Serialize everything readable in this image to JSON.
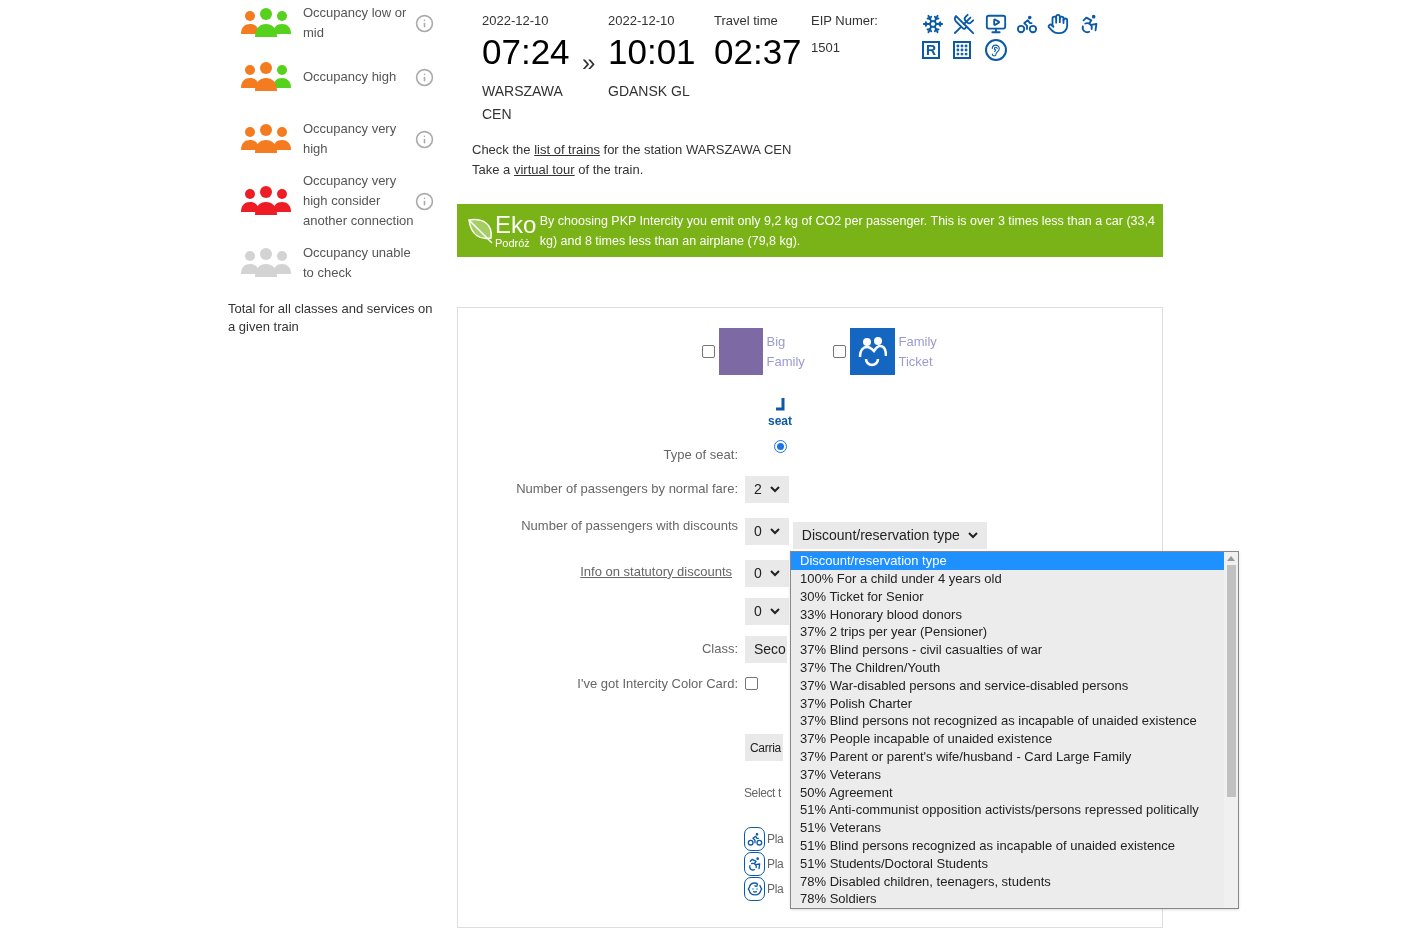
{
  "occupancy_legend": [
    {
      "kind": "low_mid",
      "label": "Occupancy low or mid"
    },
    {
      "kind": "high",
      "label": "Occupancy high"
    },
    {
      "kind": "very_high",
      "label": "Occupancy very high"
    },
    {
      "kind": "critical",
      "label": "Occupancy very high consider another connection"
    },
    {
      "kind": "unknown",
      "label": "Occupancy unable to check"
    }
  ],
  "legend_note": "Total for all classes and services on a given train",
  "journey": {
    "departure": {
      "date": "2022-12-10",
      "time": "07:24",
      "station": "WARSZAWA CEN"
    },
    "separator": "»",
    "arrival": {
      "date": "2022-12-10",
      "time": "10:01",
      "station": "GDANSK GL"
    },
    "travel_time": {
      "label": "Travel time",
      "value": "02:37"
    },
    "train_number": {
      "label": "EIP Numer:",
      "value": "1501"
    },
    "services": [
      {
        "kind": "aircon"
      },
      {
        "kind": "restaurant"
      },
      {
        "kind": "screen"
      },
      {
        "kind": "bike"
      },
      {
        "kind": "touch"
      },
      {
        "kind": "wheelchair"
      },
      {
        "kind": "reservation",
        "label": "R"
      },
      {
        "kind": "braille"
      },
      {
        "kind": "hearing"
      }
    ]
  },
  "links": [
    {
      "before": "Check the ",
      "link": "list of trains",
      "after": " for the station WARSZAWA CEN"
    },
    {
      "before": "Take a ",
      "link": "virtual tour",
      "after": " of the train."
    }
  ],
  "eco_banner": {
    "logo_title": "Eko",
    "logo_subtitle": "Podróż",
    "text": "By choosing PKP Intercity you emit only 9,2 kg of CO2 per passenger. This is over 3 times less than a car (33,4  kg) and 8 times less than an airplane (79,8 kg)."
  },
  "offers": [
    {
      "kind": "big_family",
      "label": "Big Family",
      "checked": false
    },
    {
      "kind": "family_ticket",
      "label": "Family Ticket",
      "checked": false
    }
  ],
  "seat_types": [
    {
      "label": "seat",
      "selected": true
    }
  ],
  "seat_type_label": "Type of seat:",
  "normal_fare": {
    "label": "Number of passengers by normal fare:",
    "value": "2"
  },
  "discount_rows": [
    {
      "label": "Number of passengers with discounts",
      "count": "0",
      "type": "Discount/reservation type"
    },
    {
      "link": "Info on statutory discounts",
      "count": "0"
    },
    {
      "count": "0"
    }
  ],
  "class": {
    "label": "Class:",
    "value": "Seco"
  },
  "color_card": {
    "label": "I've got Intercity Color Card:",
    "checked": false
  },
  "carriage_button": "Carria",
  "select_text": "Select t",
  "places": [
    {
      "kind": "bike",
      "label": "Pla"
    },
    {
      "kind": "wheelchair",
      "label": "Pla"
    },
    {
      "kind": "family",
      "label": "Pla"
    }
  ],
  "dropdown": {
    "options": [
      {
        "label": "Discount/reservation type",
        "selected": true
      },
      {
        "label": "100% For a child under 4 years old",
        "selected": false
      },
      {
        "label": "30% Ticket for Senior",
        "selected": false
      },
      {
        "label": "33% Honorary blood donors",
        "selected": false
      },
      {
        "label": "37% 2 trips per year (Pensioner)",
        "selected": false
      },
      {
        "label": "37% Blind persons - civil casualties of war",
        "selected": false
      },
      {
        "label": "37% The Children/Youth",
        "selected": false
      },
      {
        "label": "37% War-disabled persons and service-disabled persons",
        "selected": false
      },
      {
        "label": "37% Polish Charter",
        "selected": false
      },
      {
        "label": "37% Blind persons not recognized as incapable of unaided existence",
        "selected": false
      },
      {
        "label": "37% People incapable of unaided existence",
        "selected": false
      },
      {
        "label": "37% Parent or parent's wife/husband - Card Large Family",
        "selected": false
      },
      {
        "label": "37% Veterans",
        "selected": false
      },
      {
        "label": "50% Agreement",
        "selected": false
      },
      {
        "label": "51% Anti-communist opposition activists/persons repressed politically",
        "selected": false
      },
      {
        "label": "51% Veterans",
        "selected": false
      },
      {
        "label": "51% Blind persons recognized as incapable of unaided existence",
        "selected": false
      },
      {
        "label": "51% Students/Doctoral Students",
        "selected": false
      },
      {
        "label": "78% Disabled children, teenagers, students",
        "selected": false
      },
      {
        "label": "78% Soldiers",
        "selected": false
      }
    ]
  }
}
